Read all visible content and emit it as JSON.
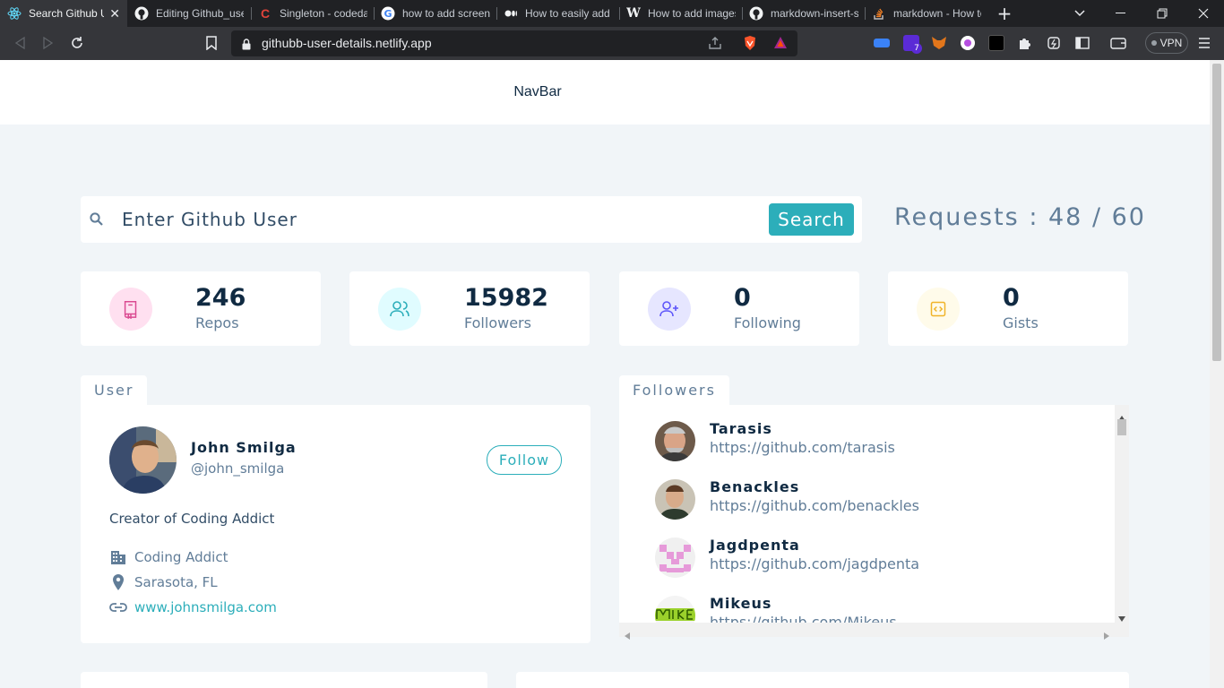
{
  "browser": {
    "tabs": [
      {
        "title": "Search Github User",
        "favicon": "react-icon",
        "active": true
      },
      {
        "title": "Editing Github_user",
        "favicon": "github-icon"
      },
      {
        "title": "Singleton - codedamn",
        "favicon": "codedamn-icon"
      },
      {
        "title": "how to add screenshot",
        "favicon": "google-icon"
      },
      {
        "title": "How to easily add",
        "favicon": "medium-icon"
      },
      {
        "title": "How to add images",
        "favicon": "wikipedia-icon"
      },
      {
        "title": "markdown-insert-screenshot",
        "favicon": "github-icon"
      },
      {
        "title": "markdown - How to",
        "favicon": "stackoverflow-icon"
      }
    ],
    "new_tab": "+",
    "url": "githubb-user-details.netlify.app",
    "vpn_label": "VPN",
    "extension_badge": "7"
  },
  "page": {
    "navbar": "NavBar",
    "search": {
      "placeholder": "Enter Github User",
      "button": "Search"
    },
    "requests": "Requests : 48 / 60",
    "stats": [
      {
        "value": "246",
        "label": "Repos",
        "icon": "book-icon",
        "color": "#da4a91",
        "bg": "#ffe0f0"
      },
      {
        "value": "15982",
        "label": "Followers",
        "icon": "users-icon",
        "color": "#2caeba",
        "bg": "#e0fcff"
      },
      {
        "value": "0",
        "label": "Following",
        "icon": "user-plus-icon",
        "color": "#5d55fa",
        "bg": "#e6e6ff"
      },
      {
        "value": "0",
        "label": "Gists",
        "icon": "code-icon",
        "color": "#f0b429",
        "bg": "#fffbea"
      }
    ],
    "user_card": {
      "tab": "User",
      "name": "John Smilga",
      "handle": "@john_smilga",
      "follow": "Follow",
      "bio": "Creator of Coding Addict",
      "company": "Coding Addict",
      "location": "Sarasota, FL",
      "blog": "www.johnsmilga.com"
    },
    "followers_card": {
      "tab": "Followers",
      "items": [
        {
          "name": "Tarasis",
          "url": "https://github.com/tarasis"
        },
        {
          "name": "Benackles",
          "url": "https://github.com/benackles"
        },
        {
          "name": "Jagdpenta",
          "url": "https://github.com/jagdpenta"
        },
        {
          "name": "Mikeus",
          "url": "https://github.com/Mikeus"
        }
      ]
    }
  }
}
